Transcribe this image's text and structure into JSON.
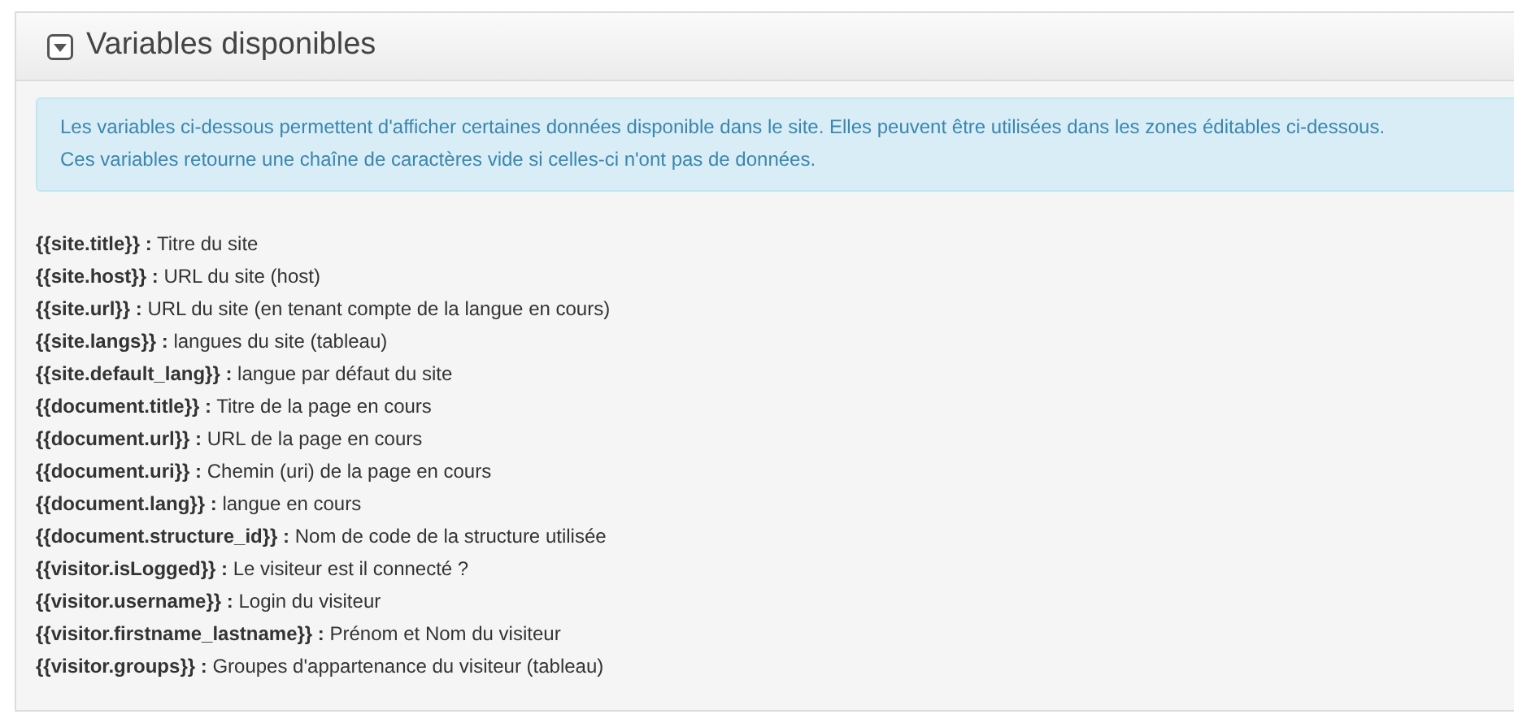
{
  "panel": {
    "title": "Variables disponibles",
    "expanded": true
  },
  "alert": {
    "lines": [
      "Les variables ci-dessous permettent d'afficher certaines données disponible dans le site. Elles peuvent être utilisées dans les zones éditables ci-dessous.",
      "Ces variables retourne une chaîne de caractères vide si celles-ci n'ont pas de données."
    ]
  },
  "variables": [
    "**{{site.title}} :** Titre du site",
    "**{{site.host}} :** URL du site (host)",
    "**{{site.url}} :** URL du site (en tenant compte de la langue en cours)",
    "**{{site.langs}} :** langues du site (tableau)",
    "**{{site.default_lang}} :** langue par défaut du site",
    "**{{document.title}} :** Titre de la page en cours",
    "**{{document.url}} :** URL de la page en cours",
    "**{{document.uri}} :** Chemin (uri) de la page en cours",
    "**{{document.lang}} :** langue en cours",
    "**{{document.structure_id}} :** Nom de code de la structure utilisée",
    "**{{visitor.isLogged}} :** Le visiteur est il connecté ?",
    "**{{visitor.username}} :** Login du visiteur",
    "**{{visitor.firstname_lastname}} :** Prénom et Nom du visiteur",
    "**{{visitor.groups}} :** Groupes d'appartenance du visiteur (tableau)"
  ]
}
